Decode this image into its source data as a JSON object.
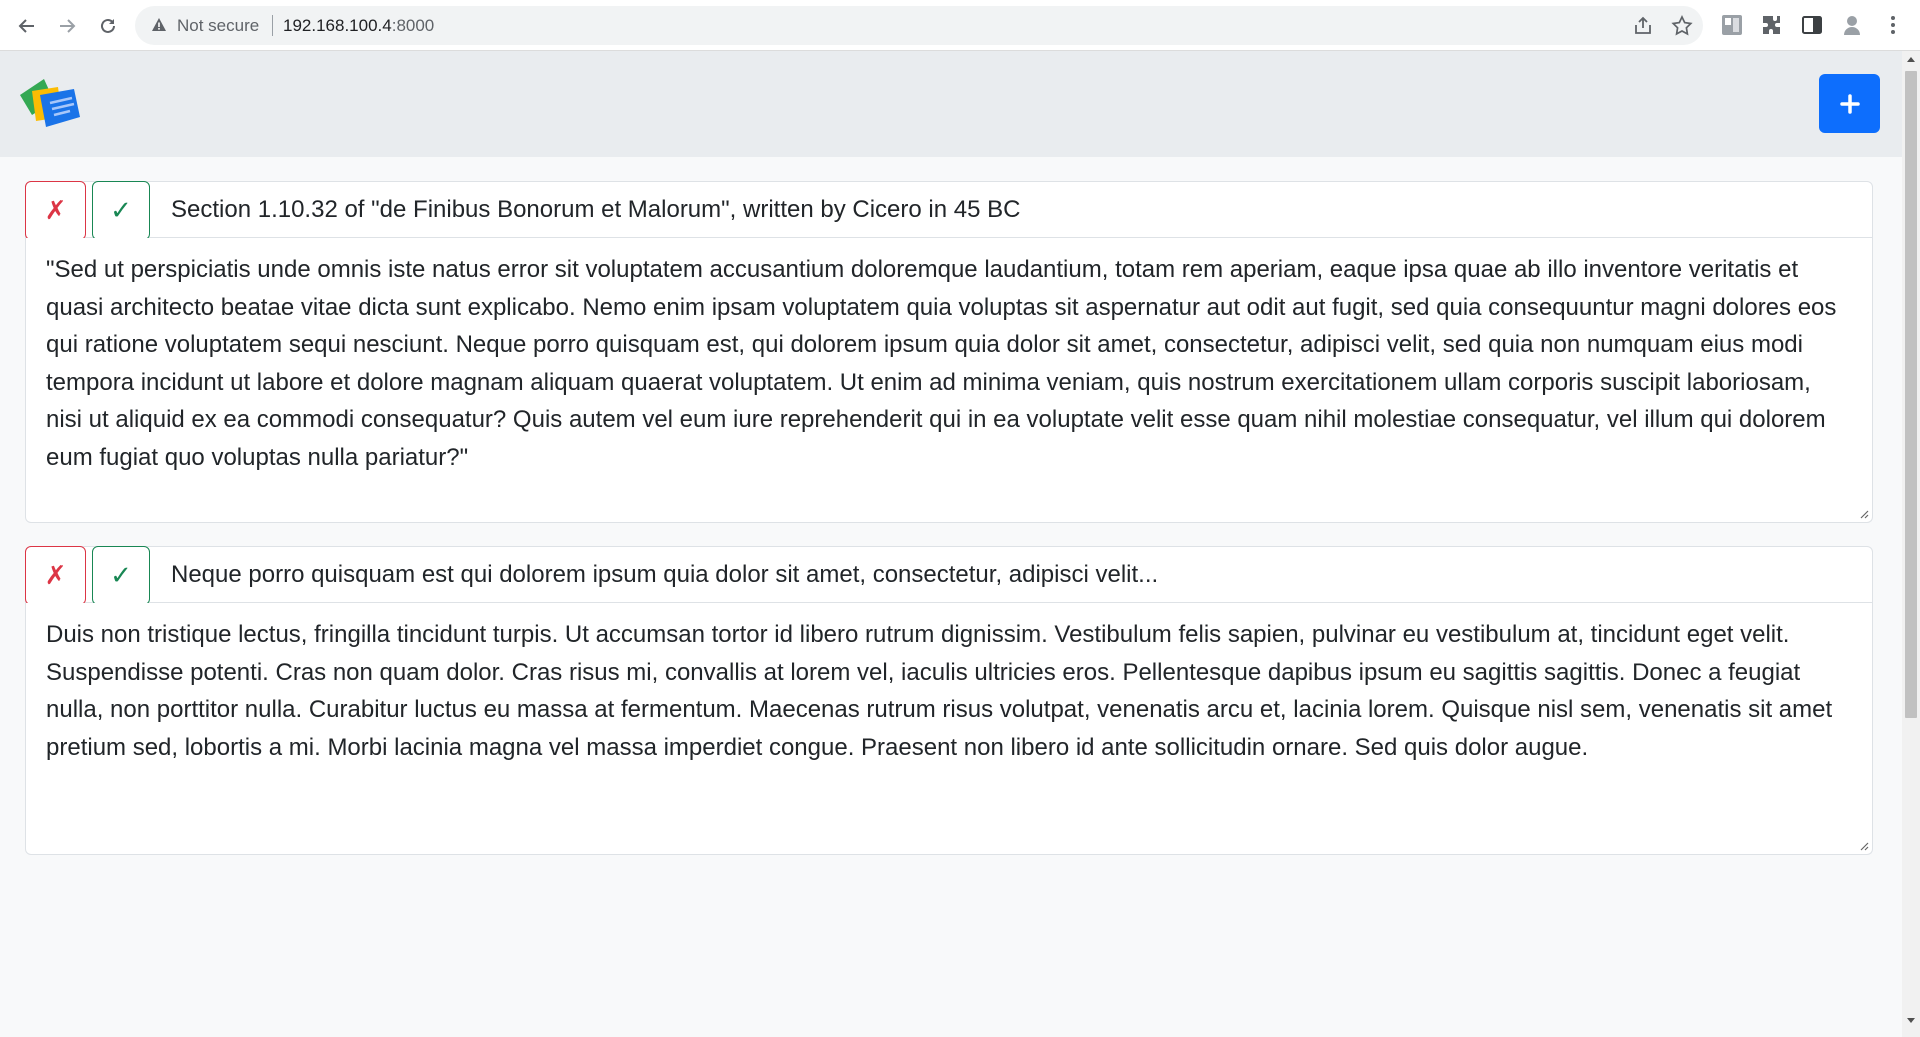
{
  "browser": {
    "security_label": "Not secure",
    "url_host": "192.168.100.4",
    "url_port": ":8000"
  },
  "app": {
    "add_button_label": "+"
  },
  "cards": [
    {
      "reject_label": "✗",
      "accept_label": "✓",
      "title": "Section 1.10.32 of \"de Finibus Bonorum et Malorum\", written by Cicero in 45 BC",
      "body": "\"Sed ut perspiciatis unde omnis iste natus error sit voluptatem accusantium doloremque laudantium, totam rem aperiam, eaque ipsa quae ab illo inventore veritatis et quasi architecto beatae vitae dicta sunt explicabo. Nemo enim ipsam voluptatem quia voluptas sit aspernatur aut odit aut fugit, sed quia consequuntur magni dolores eos qui ratione voluptatem sequi nesciunt. Neque porro quisquam est, qui dolorem ipsum quia dolor sit amet, consectetur, adipisci velit, sed quia non numquam eius modi tempora incidunt ut labore et dolore magnam aliquam quaerat voluptatem. Ut enim ad minima veniam, quis nostrum exercitationem ullam corporis suscipit laboriosam, nisi ut aliquid ex ea commodi consequatur? Quis autem vel eum iure reprehenderit qui in ea voluptate velit esse quam nihil molestiae consequatur, vel illum qui dolorem eum fugiat quo voluptas nulla pariatur?\""
    },
    {
      "reject_label": "✗",
      "accept_label": "✓",
      "title": "Neque porro quisquam est qui dolorem ipsum quia dolor sit amet, consectetur, adipisci velit...",
      "body": "Duis non tristique lectus, fringilla tincidunt turpis. Ut accumsan tortor id libero rutrum dignissim. Vestibulum felis sapien, pulvinar eu vestibulum at, tincidunt eget velit. Suspendisse potenti. Cras non quam dolor. Cras risus mi, convallis at lorem vel, iaculis ultricies eros. Pellentesque dapibus ipsum eu sagittis sagittis. Donec a feugiat nulla, non porttitor nulla. Curabitur luctus eu massa at fermentum. Maecenas rutrum risus volutpat, venenatis arcu et, lacinia lorem. Quisque nisl sem, venenatis sit amet pretium sed, lobortis a mi. Morbi lacinia magna vel massa imperdiet congue. Praesent non libero id ante sollicitudin ornare. Sed quis dolor augue."
    }
  ],
  "colors": {
    "primary": "#0d6efd",
    "danger": "#dc3545",
    "success": "#198754",
    "navbar_bg": "#e9ecef"
  },
  "icons": [
    "back-icon",
    "forward-icon",
    "reload-icon",
    "warning-icon",
    "share-icon",
    "star-icon",
    "extensions-icon",
    "sidepanel-icon",
    "profile-icon",
    "menu-icon",
    "app-logo",
    "plus-icon"
  ]
}
